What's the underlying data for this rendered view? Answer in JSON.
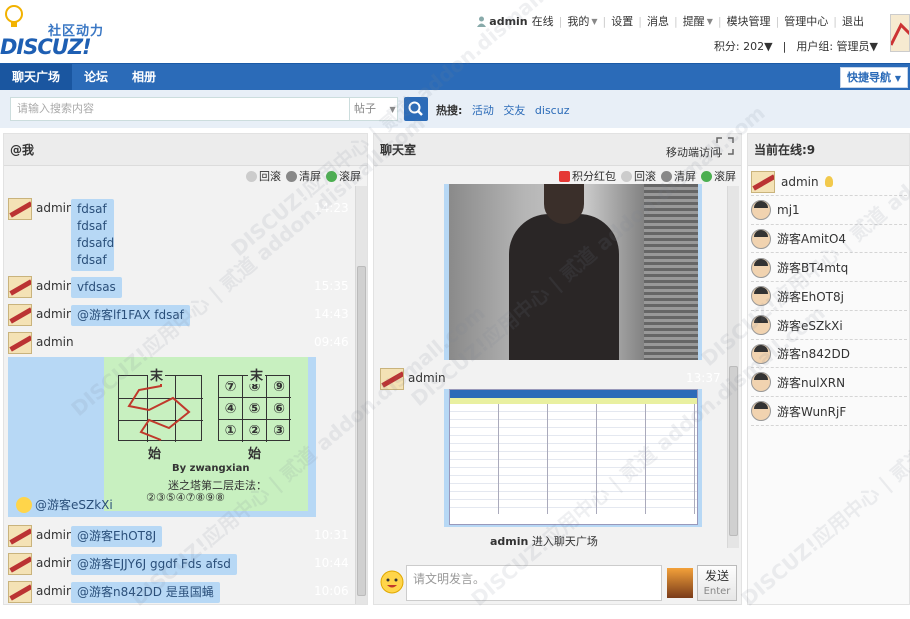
{
  "header": {
    "logo_cn": "社区动力",
    "logo_en": "DISCUZ!",
    "user": "admin",
    "user_status": "在线",
    "links": [
      "我的",
      "设置",
      "消息",
      "提醒",
      "模块管理",
      "管理中心",
      "退出"
    ],
    "points": "积分: 202",
    "group": "用户组: 管理员"
  },
  "nav": {
    "items": [
      "聊天广场",
      "论坛",
      "相册"
    ],
    "quick": "快捷导航"
  },
  "search": {
    "placeholder": "请输入搜索内容",
    "scope": "帖子",
    "hot_label": "热搜:",
    "hot_tags": [
      "活动",
      "交友",
      "discuz"
    ]
  },
  "left_panel": {
    "title": "@我",
    "tools": [
      "回滚",
      "清屏",
      "滚屏"
    ],
    "messages": [
      {
        "user": "admin",
        "lines": [
          "fdsaf",
          "fdsaf",
          "fdsafd",
          "fdsaf"
        ],
        "time": "14:23"
      },
      {
        "user": "admin",
        "lines": [
          "vfdsas"
        ],
        "time": "15:35"
      },
      {
        "user": "admin",
        "lines": [
          "@游客lf1FAX fdsaf"
        ],
        "time": "14:43"
      },
      {
        "user": "admin",
        "lines": [],
        "time": "09:46"
      },
      {
        "user": "admin",
        "lines": [
          "@游客EhOT8J"
        ],
        "time": "10:31"
      },
      {
        "user": "admin",
        "lines": [
          "@游客EJJY6J ggdf Fds afsd"
        ],
        "time": "10:44"
      },
      {
        "user": "admin",
        "lines": [
          "@游客n842DD 是虽国蝇"
        ],
        "time": "10:06"
      }
    ],
    "puzzle": {
      "label_top": "末",
      "label_bottom": "始",
      "author": "By zwangxian",
      "caption": "迷之塔第二层走法：",
      "sequence": "②③⑤④⑦⑧⑨⑧",
      "grid": [
        "⑦",
        "⑧",
        "⑨",
        "④",
        "⑤",
        "⑥",
        "①",
        "②",
        "③"
      ],
      "mention": "@游客eSZkXi"
    }
  },
  "mid_panel": {
    "title": "聊天室",
    "mobile": "移动端访问",
    "tools": [
      "积分红包",
      "回滚",
      "清屏",
      "滚屏"
    ],
    "message_user": "admin",
    "message_time": "13:37",
    "welcome": "欢迎admin 进入聊天广场",
    "welcome_user": "admin",
    "welcome_text": " 进入聊天广场",
    "input_placeholder": "请文明发言。",
    "send": "发送",
    "send_sub": "Enter"
  },
  "right_panel": {
    "title": "当前在线:9",
    "users": [
      "admin",
      "mj1",
      "游客AmitO4",
      "游客BT4mtq",
      "游客EhOT8j",
      "游客eSZkXi",
      "游客n842DD",
      "游客nulXRN",
      "游客WunRjF"
    ]
  },
  "watermark": "DISCUZ!应用中心 | 贰道 addon.dismall.com"
}
